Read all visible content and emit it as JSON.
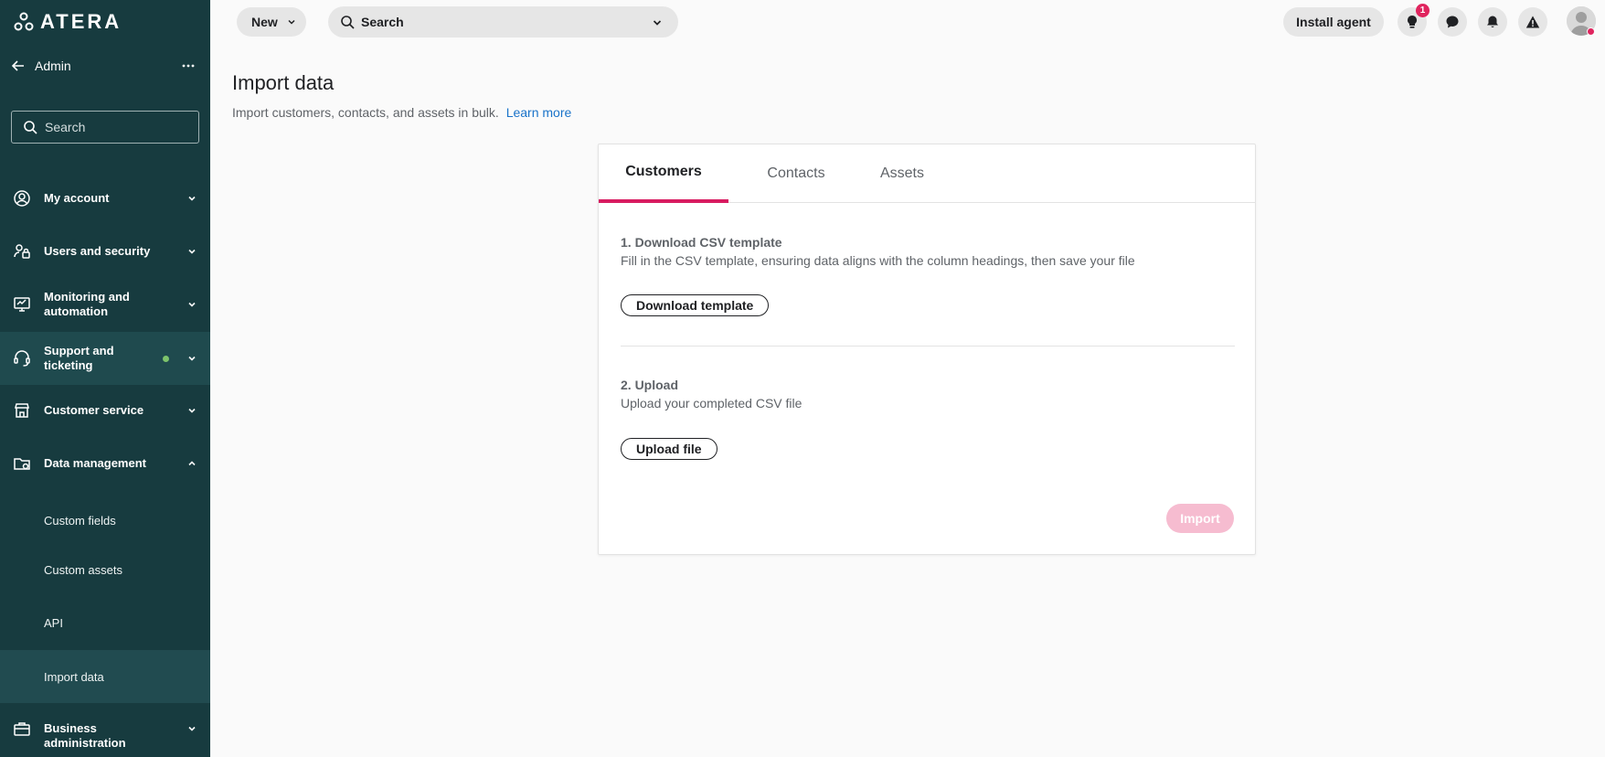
{
  "brand": {
    "logo_text": "ATERA"
  },
  "sidebar": {
    "header_label": "Admin",
    "search_placeholder": "Search",
    "items": [
      {
        "label": "My account",
        "icon": "user-circle-icon"
      },
      {
        "label": "Users and security",
        "icon": "users-lock-icon"
      },
      {
        "label": "Monitoring and automation",
        "icon": "monitor-icon"
      },
      {
        "label": "Support and ticketing",
        "icon": "headset-icon",
        "status_color": "#7dc36b"
      },
      {
        "label": "Customer service",
        "icon": "store-icon"
      },
      {
        "label": "Data management",
        "icon": "folder-data-icon",
        "expanded": true
      },
      {
        "label": "Business administration",
        "icon": "briefcase-icon"
      }
    ],
    "sub_items": [
      {
        "label": "Custom fields"
      },
      {
        "label": "Custom assets"
      },
      {
        "label": "API"
      },
      {
        "label": "Import data"
      }
    ]
  },
  "topbar": {
    "new_label": "New",
    "search_label": "Search",
    "install_label": "Install agent",
    "notification_count": "1"
  },
  "page": {
    "title": "Import data",
    "description": "Import customers, contacts, and assets in bulk.",
    "learn_more": "Learn more"
  },
  "card": {
    "tabs": [
      {
        "label": "Customers"
      },
      {
        "label": "Contacts"
      },
      {
        "label": "Assets"
      }
    ],
    "step1": {
      "title": "1. Download CSV template",
      "description": "Fill in the CSV template, ensuring data aligns with the column headings, then save your file",
      "button": "Download template"
    },
    "step2": {
      "title": "2. Upload",
      "description": "Upload your completed CSV file",
      "button": "Upload file"
    },
    "import_label": "Import"
  },
  "colors": {
    "sidebar_bg": "#173b3f",
    "accent": "#d81b60",
    "link": "#1a73c9",
    "import_disabled": "#f6bcd0"
  }
}
